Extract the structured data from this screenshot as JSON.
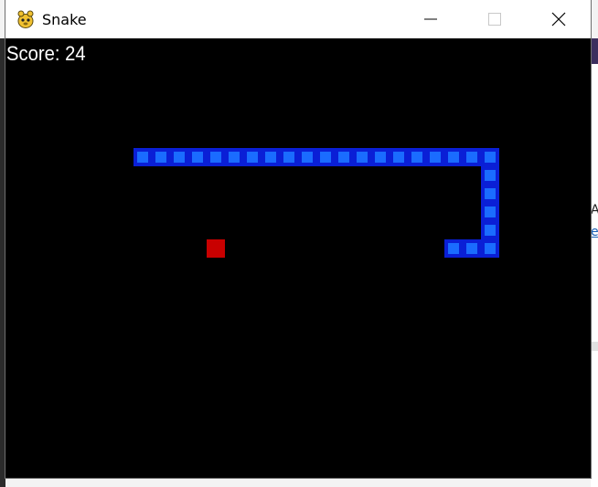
{
  "window": {
    "title": "Snake",
    "controls": {
      "minimize_icon": "minimize-icon",
      "maximize_icon": "maximize-icon",
      "close_icon": "close-icon"
    }
  },
  "game": {
    "score_text": "Score: 24",
    "grid_cell_units": 20,
    "colors": {
      "background": "#000000",
      "snake_outer": "#0a1fd6",
      "snake_inner": "#1a6cff",
      "food": "#c80000",
      "score_text": "#ffffff"
    },
    "snake": [
      [
        7,
        6
      ],
      [
        8,
        6
      ],
      [
        9,
        6
      ],
      [
        10,
        6
      ],
      [
        11,
        6
      ],
      [
        12,
        6
      ],
      [
        13,
        6
      ],
      [
        14,
        6
      ],
      [
        15,
        6
      ],
      [
        16,
        6
      ],
      [
        17,
        6
      ],
      [
        18,
        6
      ],
      [
        19,
        6
      ],
      [
        20,
        6
      ],
      [
        21,
        6
      ],
      [
        22,
        6
      ],
      [
        23,
        6
      ],
      [
        24,
        6
      ],
      [
        25,
        6
      ],
      [
        26,
        6
      ],
      [
        26,
        7
      ],
      [
        26,
        8
      ],
      [
        26,
        9
      ],
      [
        26,
        10
      ],
      [
        26,
        11
      ],
      [
        25,
        11
      ],
      [
        24,
        11
      ]
    ],
    "food": [
      11,
      11
    ]
  },
  "background_fragments": {
    "text_1": "A",
    "text_2": "e"
  }
}
